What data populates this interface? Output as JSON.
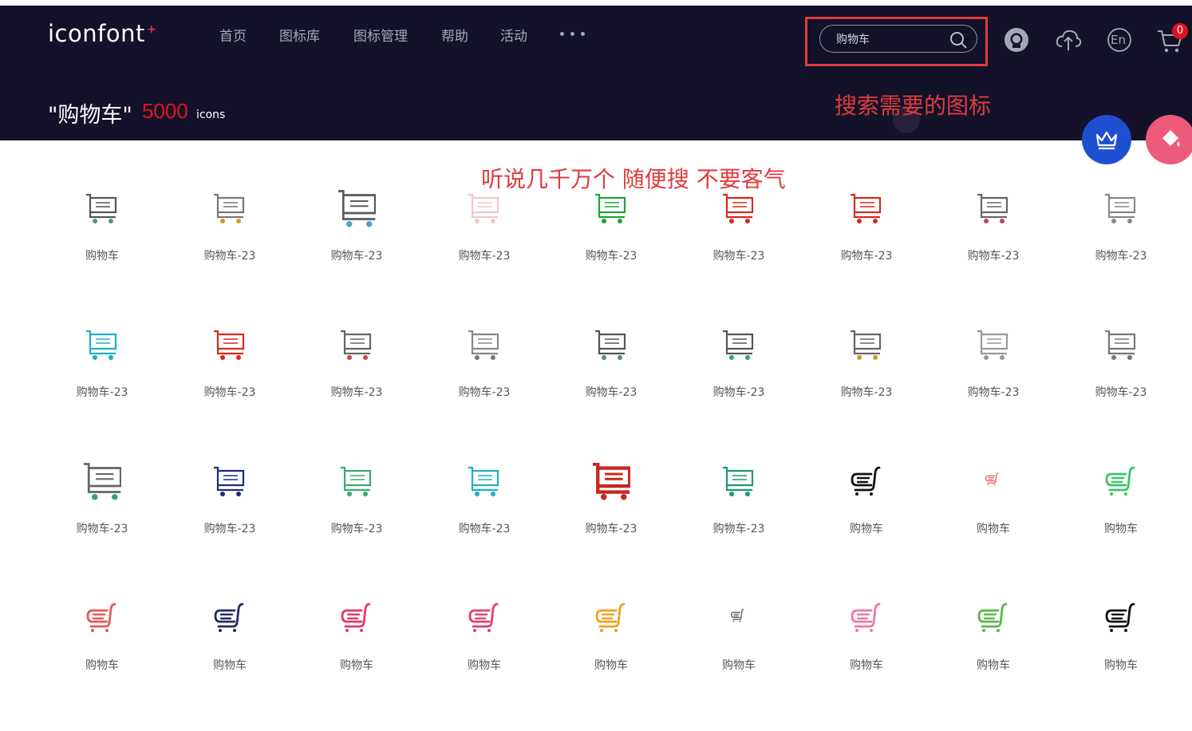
{
  "header": {
    "logo": "iconfont",
    "logo_mark": "+",
    "nav": [
      "首页",
      "图标库",
      "图标管理",
      "帮助",
      "活动"
    ],
    "nav_more_icon": "ellipsis-icon",
    "search": {
      "value": "购物车",
      "placeholder": ""
    },
    "icons": [
      "github-icon",
      "upload-cloud-icon",
      "language-en-icon",
      "cart-icon"
    ],
    "language_label": "En",
    "cart_count": "0"
  },
  "result": {
    "query": "\"购物车\"",
    "count": "5000",
    "unit": "icons"
  },
  "annotations": {
    "search_hint": "搜索需要的图标",
    "grid_hint": "听说几千万个  随便搜 不要客气"
  },
  "fabs": [
    "crown-icon",
    "paint-bucket-icon"
  ],
  "colors": {
    "header_bg": "#13122a",
    "accent_red": "#e4141e",
    "annotation": "#e03b3b",
    "crown_fab": "#1f4fd1",
    "paint_fab": "#ee5a7a"
  },
  "icon_grid": [
    {
      "label": "购物车",
      "style": "cart",
      "color": "#555555",
      "wheels": "#4a9a8a"
    },
    {
      "label": "购物车-23",
      "style": "cart",
      "color": "#777777",
      "wheels": "#c5a321"
    },
    {
      "label": "购物车-23",
      "style": "cart-large",
      "color": "#5a5a5a",
      "wheels": "#4aa3d1"
    },
    {
      "label": "购物车-23",
      "style": "cart",
      "color": "#f2c7cb",
      "wheels": "#f2c7cb"
    },
    {
      "label": "购物车-23",
      "style": "cart",
      "color": "#22a33a",
      "wheels": "#22a33a"
    },
    {
      "label": "购物车-23",
      "style": "cart",
      "color": "#d42a1f",
      "wheels": "#d42a1f"
    },
    {
      "label": "购物车-23",
      "style": "cart",
      "color": "#d42a1f",
      "wheels": "#d42a1f"
    },
    {
      "label": "购物车-23",
      "style": "cart",
      "color": "#666666",
      "wheels": "#b04a6a"
    },
    {
      "label": "购物车-23",
      "style": "cart",
      "color": "#888888",
      "wheels": "#888888"
    },
    {
      "label": "购物车-23",
      "style": "cart",
      "color": "#1fb0c0",
      "wheels": "#1fb0c0"
    },
    {
      "label": "购物车-23",
      "style": "cart",
      "color": "#d42a1f",
      "wheels": "#d42a1f"
    },
    {
      "label": "购物车-23",
      "style": "cart",
      "color": "#666666",
      "wheels": "#c24a3a"
    },
    {
      "label": "购物车-23",
      "style": "cart",
      "color": "#888888",
      "wheels": "#777777"
    },
    {
      "label": "购物车-23",
      "style": "cart",
      "color": "#555555",
      "wheels": "#5a8a7a"
    },
    {
      "label": "购物车-23",
      "style": "cart",
      "color": "#555555",
      "wheels": "#3a9a8a"
    },
    {
      "label": "购物车-23",
      "style": "cart",
      "color": "#666666",
      "wheels": "#c5a321"
    },
    {
      "label": "购物车-23",
      "style": "cart",
      "color": "#999999",
      "wheels": "#999999"
    },
    {
      "label": "购物车-23",
      "style": "cart",
      "color": "#777777",
      "wheels": "#777777"
    },
    {
      "label": "购物车-23",
      "style": "cart-large",
      "color": "#666666",
      "wheels": "#3a9a8a"
    },
    {
      "label": "购物车-23",
      "style": "cart",
      "color": "#1f2a7a",
      "wheels": "#1f2a7a"
    },
    {
      "label": "购物车-23",
      "style": "cart",
      "color": "#3aaa6a",
      "wheels": "#3aaa6a"
    },
    {
      "label": "购物车-23",
      "style": "cart",
      "color": "#1fb0c0",
      "wheels": "#1fb0c0"
    },
    {
      "label": "购物车-23",
      "style": "cart-bold",
      "color": "#c8281c",
      "wheels": "#c8281c"
    },
    {
      "label": "购物车-23",
      "style": "cart",
      "color": "#1a9a6a",
      "wheels": "#1a9a6a"
    },
    {
      "label": "购物车",
      "style": "basket",
      "color": "#111111",
      "wheels": "#111111"
    },
    {
      "label": "购物车",
      "style": "basket-small",
      "color": "#e0605a",
      "wheels": "#e0605a"
    },
    {
      "label": "购物车",
      "style": "basket",
      "color": "#3ac46a",
      "wheels": "#3ac46a"
    },
    {
      "label": "购物车",
      "style": "basket",
      "color": "#e8565a",
      "wheels": "#e8565a"
    },
    {
      "label": "购物车",
      "style": "basket",
      "color": "#222a6a",
      "wheels": "#222a6a"
    },
    {
      "label": "购物车",
      "style": "basket",
      "color": "#e03a6a",
      "wheels": "#e03a6a"
    },
    {
      "label": "购物车",
      "style": "basket",
      "color": "#e0406a",
      "wheels": "#e0406a"
    },
    {
      "label": "购物车",
      "style": "basket",
      "color": "#f0a020",
      "wheels": "#f0a020"
    },
    {
      "label": "购物车",
      "style": "basket-small",
      "color": "#555555",
      "wheels": "#555555"
    },
    {
      "label": "购物车",
      "style": "basket",
      "color": "#ee7aa0",
      "wheels": "#ee7aa0"
    },
    {
      "label": "购物车",
      "style": "basket",
      "color": "#5ab84a",
      "wheels": "#5ab84a"
    },
    {
      "label": "购物车",
      "style": "basket",
      "color": "#111111",
      "wheels": "#111111"
    }
  ]
}
